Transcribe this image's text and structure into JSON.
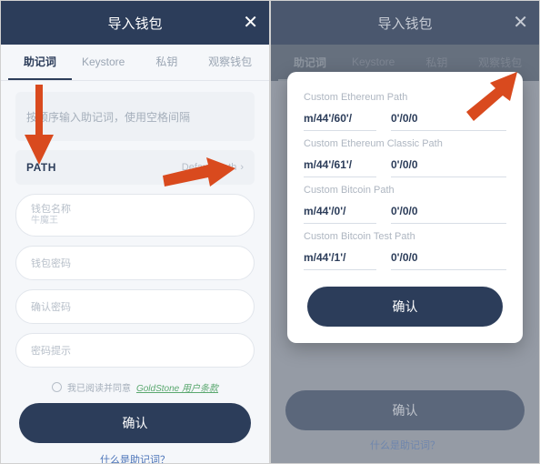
{
  "header": {
    "title": "导入钱包",
    "close": "✕"
  },
  "tabs": {
    "items": [
      {
        "label": "助记词"
      },
      {
        "label": "Keystore"
      },
      {
        "label": "私钥"
      },
      {
        "label": "观察钱包"
      }
    ]
  },
  "left": {
    "mnemonic_placeholder": "按顺序输入助记词，使用空格间隔",
    "path_label": "PATH",
    "path_value": "Default Path",
    "field_name_label": "钱包名称",
    "field_name_value": "牛魔王",
    "field_pwd": "钱包密码",
    "field_pwd2": "确认密码",
    "field_hint": "密码提示",
    "terms_prefix": "我已阅读并同意",
    "terms_link": "GoldStone 用户条款",
    "confirm": "确认",
    "footer_q": "什么是助记词？"
  },
  "right": {
    "confirm_bg": "确认",
    "footer_q": "什么是助记词？"
  },
  "modal": {
    "groups": [
      {
        "title": "Custom Ethereum Path",
        "prefix": "m/44'/60'/",
        "suffix": "0'/0/0"
      },
      {
        "title": "Custom Ethereum Classic Path",
        "prefix": "m/44'/61'/",
        "suffix": "0'/0/0"
      },
      {
        "title": "Custom Bitcoin Path",
        "prefix": "m/44'/0'/",
        "suffix": "0'/0/0"
      },
      {
        "title": "Custom Bitcoin Test Path",
        "prefix": "m/44'/1'/",
        "suffix": "0'/0/0"
      }
    ],
    "confirm": "确认"
  }
}
